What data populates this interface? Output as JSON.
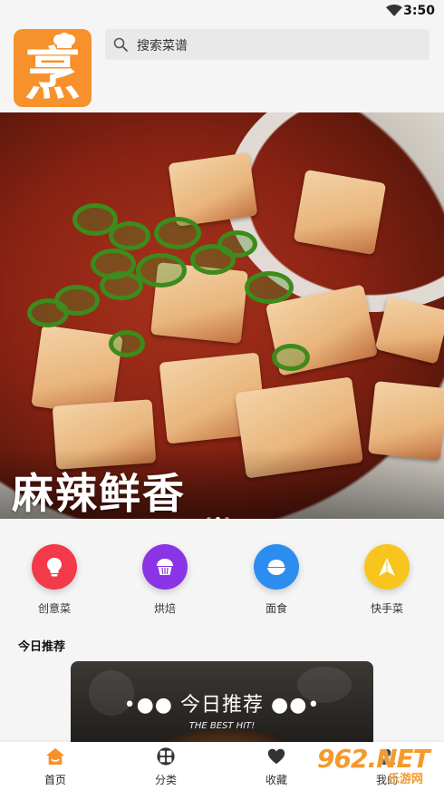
{
  "status_bar": {
    "time": "3:50",
    "wifi_icon": "wifi-icon"
  },
  "app": {
    "logo_glyph": "烹",
    "logo_icon": "chef-hat-icon",
    "brand_color": "#f7912c"
  },
  "search": {
    "placeholder": "搜索菜谱",
    "icon": "search-icon"
  },
  "banner": {
    "caption": "麻辣鲜香",
    "active_slide": 1,
    "slides": 3
  },
  "categories": [
    {
      "label": "创意菜",
      "icon": "lightbulb-icon",
      "color": "#f23a4a"
    },
    {
      "label": "烘焙",
      "icon": "cupcake-icon",
      "color": "#8b34e6"
    },
    {
      "label": "面食",
      "icon": "bowl-icon",
      "color": "#2b8df0"
    },
    {
      "label": "快手菜",
      "icon": "paper-plane-icon",
      "color": "#f7c51e"
    }
  ],
  "recommend": {
    "section_title": "今日推荐",
    "card_title": "今日推荐",
    "card_subtitle": "THE BEST HIT!"
  },
  "bottom_nav": [
    {
      "label": "首页",
      "icon": "home-icon",
      "active": true,
      "color": "#f7912c"
    },
    {
      "label": "分类",
      "icon": "category-icon",
      "active": false
    },
    {
      "label": "收藏",
      "icon": "heart-icon",
      "active": false
    },
    {
      "label": "我的",
      "icon": "user-icon",
      "active": false
    }
  ],
  "watermark": {
    "logo": "962.NET",
    "sub": "乐游网"
  }
}
